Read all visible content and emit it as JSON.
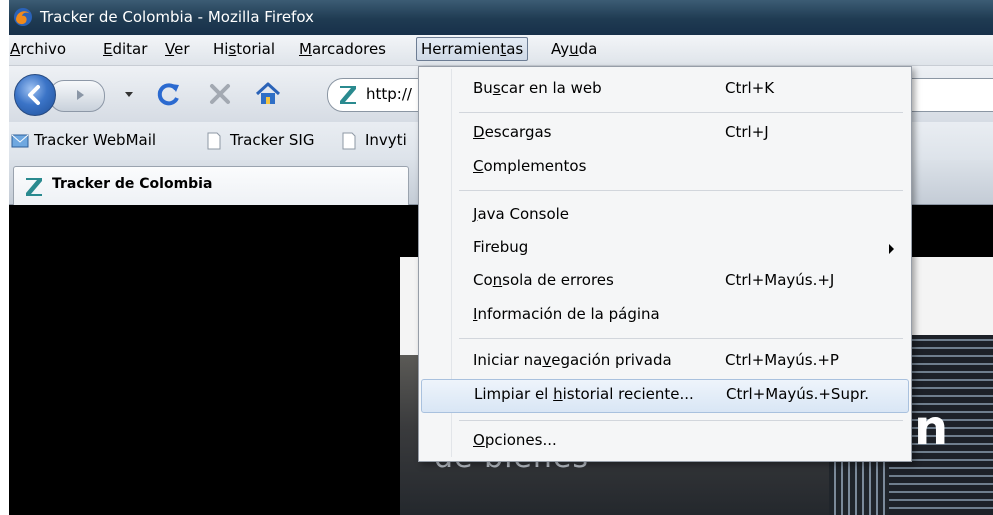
{
  "window": {
    "title": "Tracker de Colombia - Mozilla Firefox"
  },
  "menubar": {
    "archivo": "Archivo",
    "editar": "Editar",
    "ver": "Ver",
    "historial": "Historial",
    "marcadores": "Marcadores",
    "herramientas": "Herramientas",
    "ayuda": "Ayuda"
  },
  "navbar": {
    "url": "http://"
  },
  "bookmarks": [
    {
      "label": "Tracker WebMail"
    },
    {
      "label": "Tracker SIG"
    },
    {
      "label": "Invyti"
    }
  ],
  "tab": {
    "label": "Tracker de Colombia"
  },
  "page": {
    "heading_char": "n",
    "subtitle": "de bienes"
  },
  "dropdown": {
    "items": [
      {
        "label": "Buscar en la web",
        "shortcut": "Ctrl+K"
      },
      {
        "label": "Descargas",
        "shortcut": "Ctrl+J"
      },
      {
        "label": "Complementos",
        "shortcut": ""
      },
      {
        "label": "Java Console",
        "shortcut": ""
      },
      {
        "label": "Firebug",
        "shortcut": ""
      },
      {
        "label": "Consola de errores",
        "shortcut": "Ctrl+Mayús.+J"
      },
      {
        "label": "Información de la página",
        "shortcut": ""
      },
      {
        "label": "Iniciar navegación privada",
        "shortcut": "Ctrl+Mayús.+P"
      },
      {
        "label": "Limpiar el historial reciente...",
        "shortcut": "Ctrl+Mayús.+Supr."
      },
      {
        "label": "Opciones...",
        "shortcut": ""
      }
    ]
  }
}
